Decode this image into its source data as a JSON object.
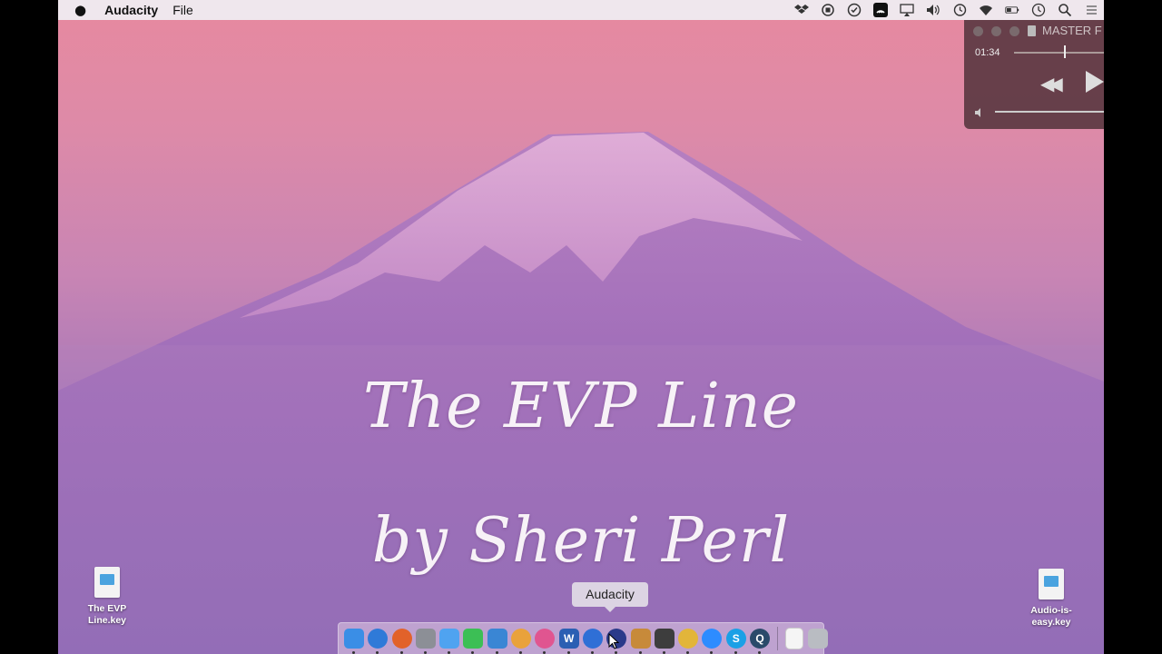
{
  "menubar": {
    "app_name": "Audacity",
    "menus": [
      "File"
    ]
  },
  "status_icons": [
    "dropbox-icon",
    "record-icon",
    "checkmark-icon",
    "wifi-app-icon",
    "airplay-icon",
    "volume-icon",
    "time-machine-icon",
    "wifi-icon",
    "battery-icon",
    "clock-icon",
    "spotlight-icon",
    "notification-center-icon"
  ],
  "slide": {
    "title": "The EVP Line",
    "subtitle": "by Sheri Perl"
  },
  "player": {
    "title": "MASTER F",
    "elapsed": "01:34",
    "progress": 0.55
  },
  "desktop_icons": [
    {
      "line1": "The EVP",
      "line2": "Line.key"
    },
    {
      "line1": "Audio-is-",
      "line2": "easy.key"
    }
  ],
  "dock": {
    "tooltip": "Audacity",
    "apps": [
      {
        "name": "finder-icon",
        "color": "#3a8ee6",
        "label": ""
      },
      {
        "name": "safari-icon",
        "color": "#2f7ad8",
        "label": ""
      },
      {
        "name": "firefox-icon",
        "color": "#e2622a",
        "label": ""
      },
      {
        "name": "preview-icon",
        "color": "#8c8f96",
        "label": ""
      },
      {
        "name": "messages-icon",
        "color": "#4fa3f0",
        "label": ""
      },
      {
        "name": "facetime-icon",
        "color": "#3cbf55",
        "label": ""
      },
      {
        "name": "keynote-icon",
        "color": "#3a86d4",
        "label": ""
      },
      {
        "name": "photos-icon",
        "color": "#e9a23b",
        "label": ""
      },
      {
        "name": "itunes-icon",
        "color": "#e05590",
        "label": ""
      },
      {
        "name": "word-icon",
        "color": "#2b5fb3",
        "label": "W"
      },
      {
        "name": "teamviewer-icon",
        "color": "#2f6fd6",
        "label": ""
      },
      {
        "name": "audacity-icon",
        "color": "#2a3a8a",
        "label": ""
      },
      {
        "name": "garageband-icon",
        "color": "#c78a3a",
        "label": ""
      },
      {
        "name": "waveform-app-icon",
        "color": "#3d3d3d",
        "label": ""
      },
      {
        "name": "chrome-icon",
        "color": "#e2b53a",
        "label": ""
      },
      {
        "name": "zoom-icon",
        "color": "#2d8cff",
        "label": ""
      },
      {
        "name": "skype-icon",
        "color": "#1aa0e6",
        "label": "S"
      },
      {
        "name": "quicktime-icon",
        "color": "#2a4a6a",
        "label": "Q"
      },
      {
        "name": "document-icon",
        "color": "#f5f5f5",
        "label": ""
      },
      {
        "name": "trash-icon",
        "color": "#b9bcc2",
        "label": ""
      }
    ]
  },
  "colors": {
    "sky_top": "#e7899f",
    "sky_bottom": "#7d65b2",
    "mountain": "#8a5aa6"
  }
}
